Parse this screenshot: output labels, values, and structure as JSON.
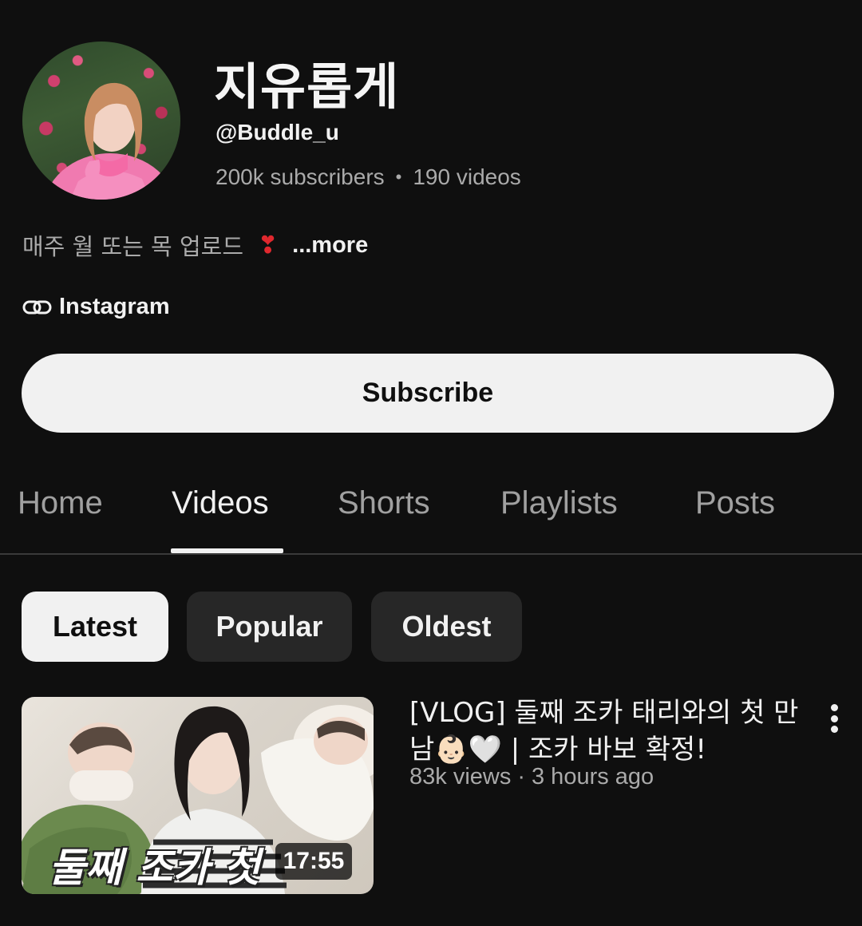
{
  "channel": {
    "name": "지유롭게",
    "handle": "@Buddle_u",
    "subscribers": "200k subscribers",
    "separator": "•",
    "videos": "190 videos",
    "description": "매주 월 또는 목 업로드",
    "description_emoji": "❣",
    "more_label": "...more",
    "link_label": "Instagram",
    "avatar_icon": "avatar-photo"
  },
  "subscribe_label": "Subscribe",
  "tabs": [
    {
      "label": "Home",
      "active": false
    },
    {
      "label": "Videos",
      "active": true
    },
    {
      "label": "Shorts",
      "active": false
    },
    {
      "label": "Playlists",
      "active": false
    },
    {
      "label": "Posts",
      "active": false
    }
  ],
  "filters": [
    {
      "label": "Latest",
      "selected": true
    },
    {
      "label": "Popular",
      "selected": false
    },
    {
      "label": "Oldest",
      "selected": false
    }
  ],
  "video": {
    "thumbnail_caption": "둘째 조카 첫",
    "duration": "17:55",
    "title": "[VLOG] 둘째 조카 태리와의 첫 만남👶🏻🤍 | 조카 바보 확정!",
    "views": "83k views",
    "meta_separator": "·",
    "time_ago": "3 hours ago"
  },
  "colors": {
    "background": "#0f0f0f",
    "primary_text": "#f1f1f1",
    "secondary_text": "#aaaaaa",
    "chip_bg": "#272727",
    "heart": "#e0282e"
  }
}
